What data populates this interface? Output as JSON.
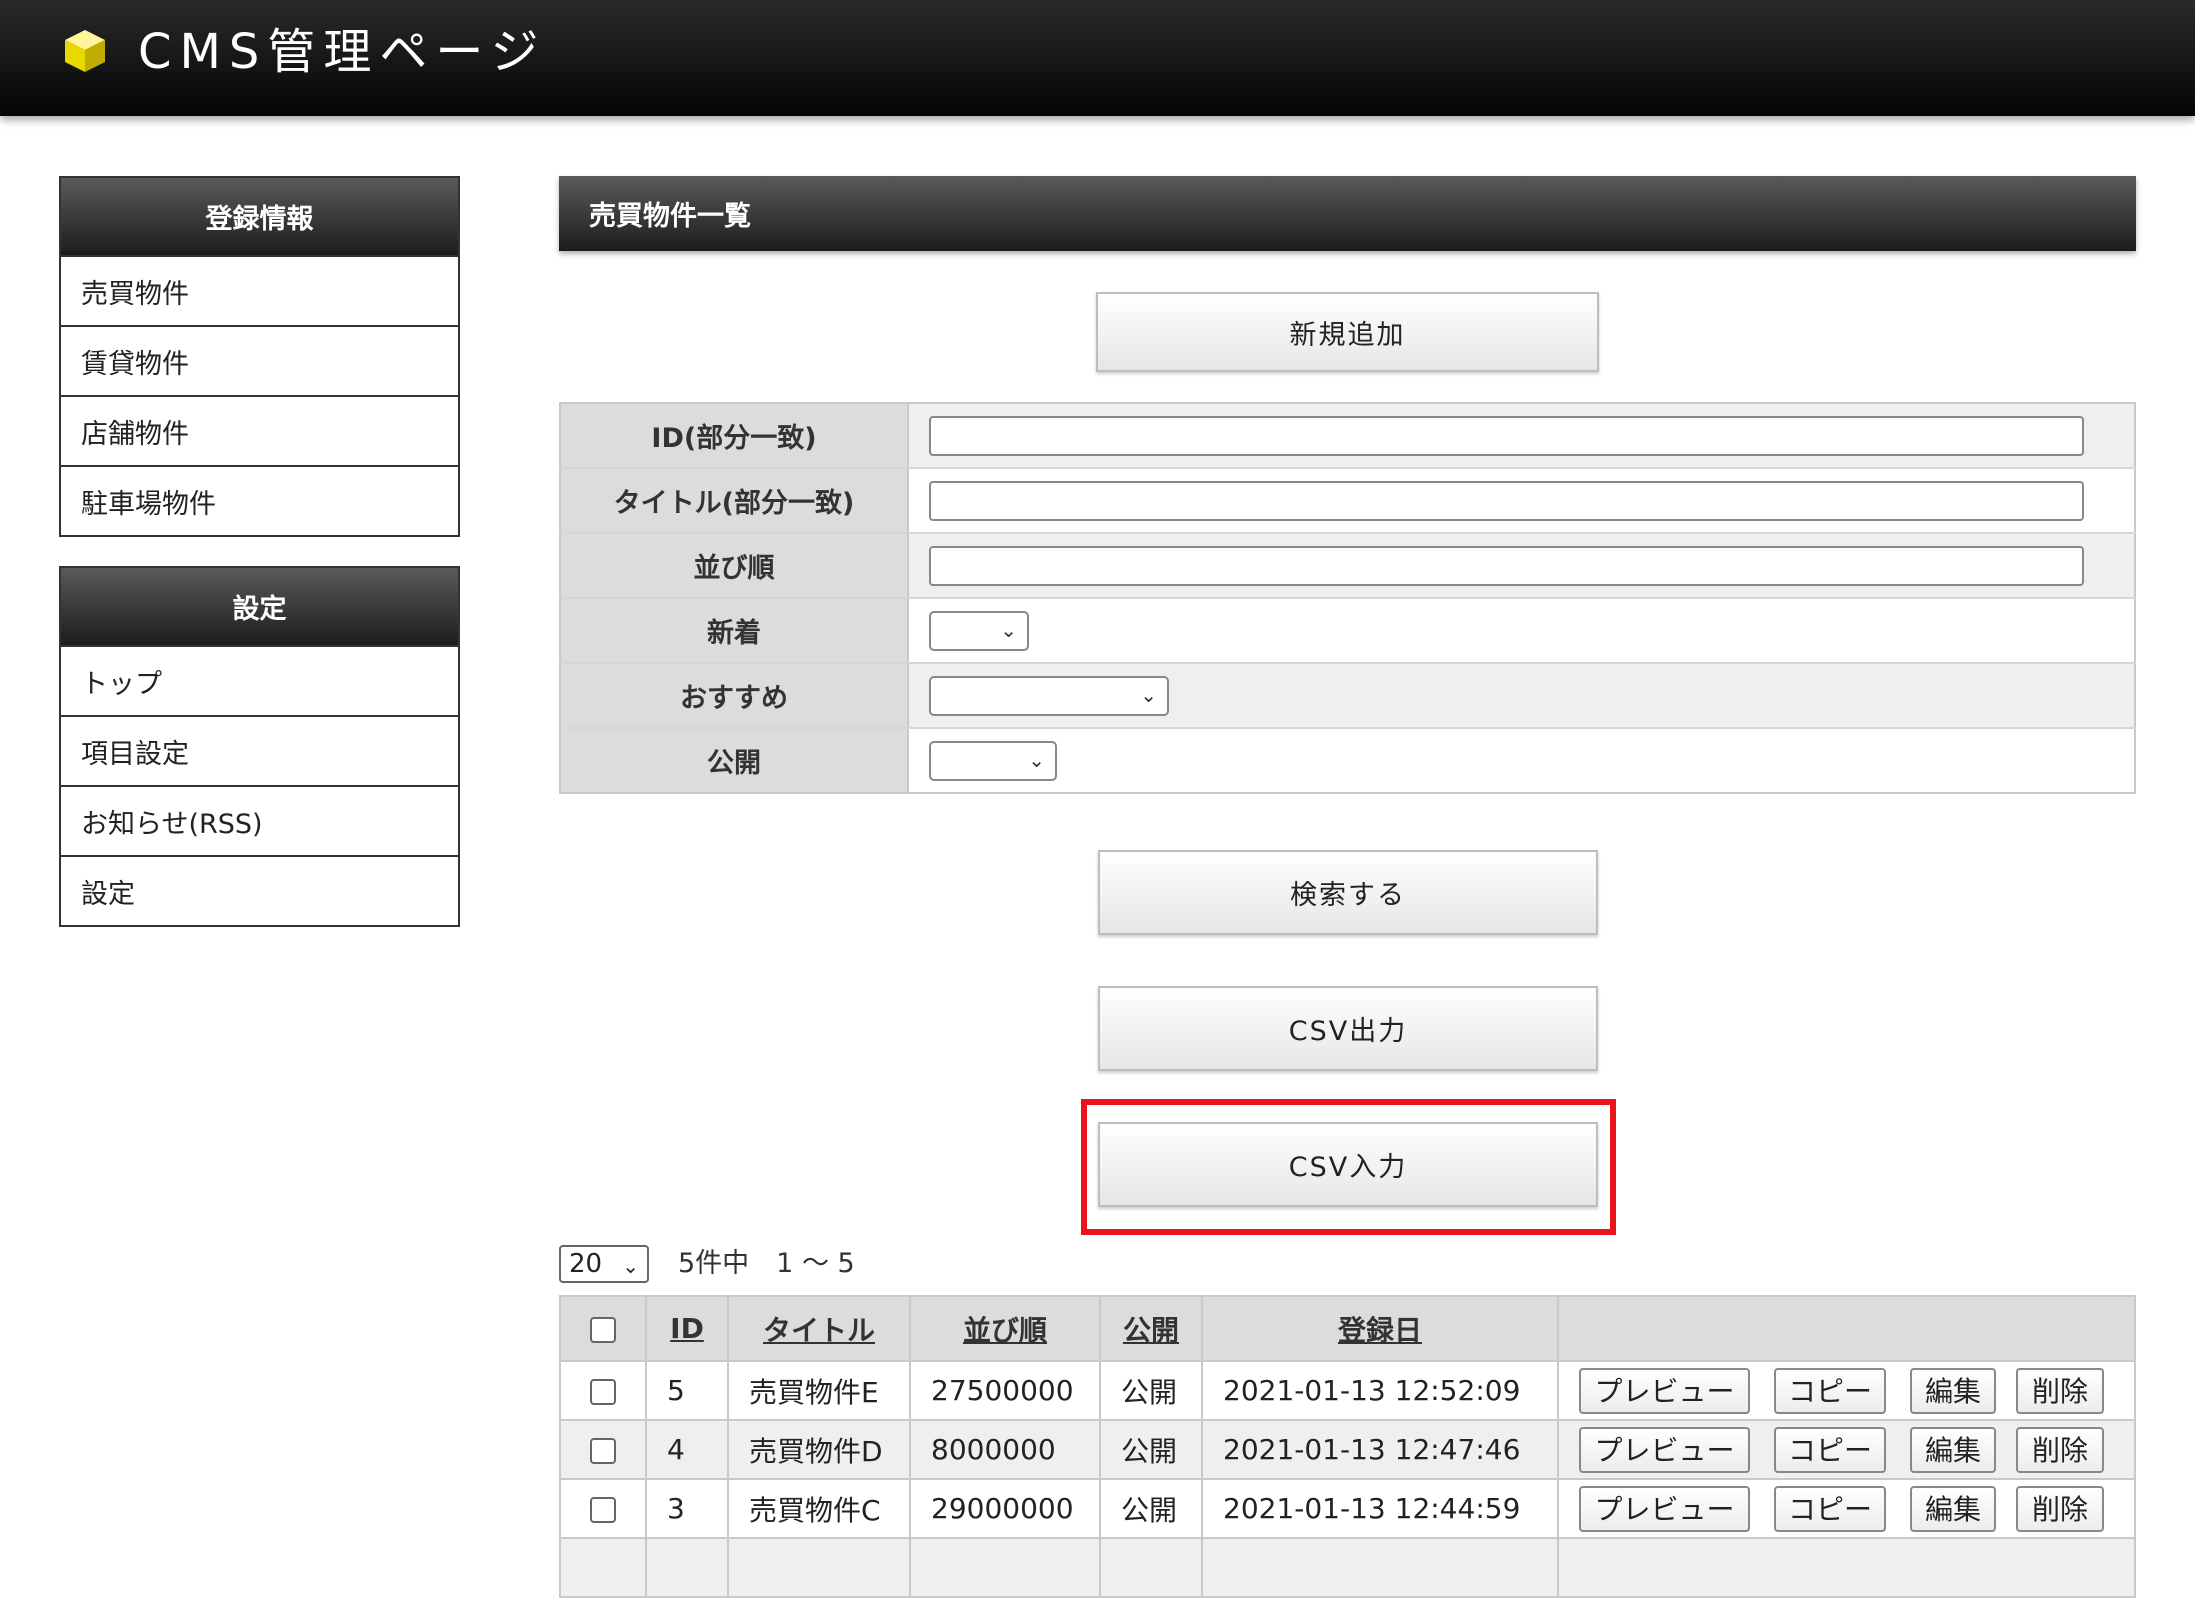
{
  "header": {
    "title": "CMS管理ページ",
    "logo_color": "#f2e600"
  },
  "sidebar": {
    "sections": [
      {
        "heading": "登録情報",
        "items": [
          "売買物件",
          "賃貸物件",
          "店舗物件",
          "駐車場物件"
        ]
      },
      {
        "heading": "設定",
        "items": [
          "トップ",
          "項目設定",
          "お知らせ(RSS)",
          "設定"
        ]
      }
    ]
  },
  "main": {
    "title": "売買物件一覧",
    "add_button": "新規追加",
    "search_form": {
      "fields": [
        {
          "label": "ID(部分一致)",
          "type": "text",
          "value": ""
        },
        {
          "label": "タイトル(部分一致)",
          "type": "text",
          "value": ""
        },
        {
          "label": "並び順",
          "type": "text",
          "value": ""
        },
        {
          "label": "新着",
          "type": "select",
          "value": ""
        },
        {
          "label": "おすすめ",
          "type": "select",
          "value": ""
        },
        {
          "label": "公開",
          "type": "select",
          "value": ""
        }
      ]
    },
    "search_button": "検索する",
    "csv_export_button": "CSV出力",
    "csv_import_button": "CSV入力",
    "highlight_color": "#e8161a",
    "pager": {
      "per_page": "20",
      "summary": "5件中　1 ～ 5"
    },
    "results": {
      "columns": [
        "ID",
        "タイトル",
        "並び順",
        "公開",
        "登録日"
      ],
      "action_labels": {
        "preview": "プレビュー",
        "copy": "コピー",
        "edit": "編集",
        "delete": "削除"
      },
      "rows": [
        {
          "id": "5",
          "title": "売買物件E",
          "order": "27500000",
          "status": "公開",
          "date": "2021-01-13 12:52:09"
        },
        {
          "id": "4",
          "title": "売買物件D",
          "order": "8000000",
          "status": "公開",
          "date": "2021-01-13 12:47:46"
        },
        {
          "id": "3",
          "title": "売買物件C",
          "order": "29000000",
          "status": "公開",
          "date": "2021-01-13 12:44:59"
        }
      ]
    }
  }
}
